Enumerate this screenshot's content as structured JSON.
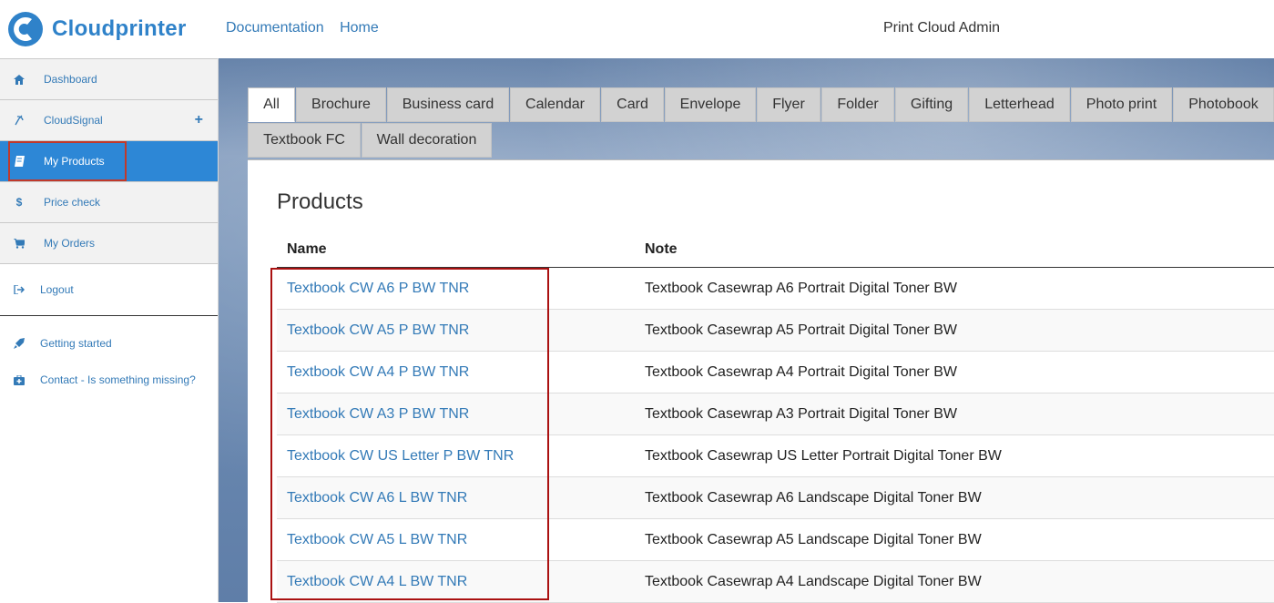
{
  "header": {
    "brand": "Cloudprinter",
    "nav": [
      "Documentation",
      "Home"
    ],
    "admin_title": "Print Cloud Admin"
  },
  "sidebar": {
    "items": [
      {
        "label": "Dashboard",
        "icon": "home-icon"
      },
      {
        "label": "CloudSignal",
        "icon": "signal-icon",
        "has_add": true
      },
      {
        "label": "My Products",
        "icon": "book-icon",
        "active": true
      },
      {
        "label": "Price check",
        "icon": "dollar-icon"
      },
      {
        "label": "My Orders",
        "icon": "cart-icon"
      }
    ],
    "logout_label": "Logout",
    "help": [
      {
        "label": "Getting started",
        "icon": "rocket-icon"
      },
      {
        "label": "Contact - Is something missing?",
        "icon": "medkit-icon"
      }
    ]
  },
  "tabs": [
    "All",
    "Brochure",
    "Business card",
    "Calendar",
    "Card",
    "Envelope",
    "Flyer",
    "Folder",
    "Gifting",
    "Letterhead",
    "Photo print",
    "Photobook",
    "Textbook FC",
    "Wall decoration"
  ],
  "active_tab": "All",
  "products": {
    "title": "Products",
    "columns": {
      "name": "Name",
      "note": "Note"
    },
    "rows": [
      {
        "name": "Textbook CW A6 P BW TNR",
        "note": "Textbook Casewrap A6 Portrait Digital Toner BW"
      },
      {
        "name": "Textbook CW A5 P BW TNR",
        "note": "Textbook Casewrap A5 Portrait Digital Toner BW"
      },
      {
        "name": "Textbook CW A4 P BW TNR",
        "note": "Textbook Casewrap A4 Portrait Digital Toner BW"
      },
      {
        "name": "Textbook CW A3 P BW TNR",
        "note": "Textbook Casewrap A3 Portrait Digital Toner BW"
      },
      {
        "name": "Textbook CW US Letter P BW TNR",
        "note": "Textbook Casewrap US Letter Portrait Digital Toner BW"
      },
      {
        "name": "Textbook CW A6 L BW TNR",
        "note": "Textbook Casewrap A6 Landscape Digital Toner BW"
      },
      {
        "name": "Textbook CW A5 L BW TNR",
        "note": "Textbook Casewrap A5 Landscape Digital Toner BW"
      },
      {
        "name": "Textbook CW A4 L BW TNR",
        "note": "Textbook Casewrap A4 Landscape Digital Toner BW"
      }
    ]
  },
  "colors": {
    "accent": "#2d87d6",
    "link": "#337ab7",
    "highlight": "#c0392b"
  }
}
